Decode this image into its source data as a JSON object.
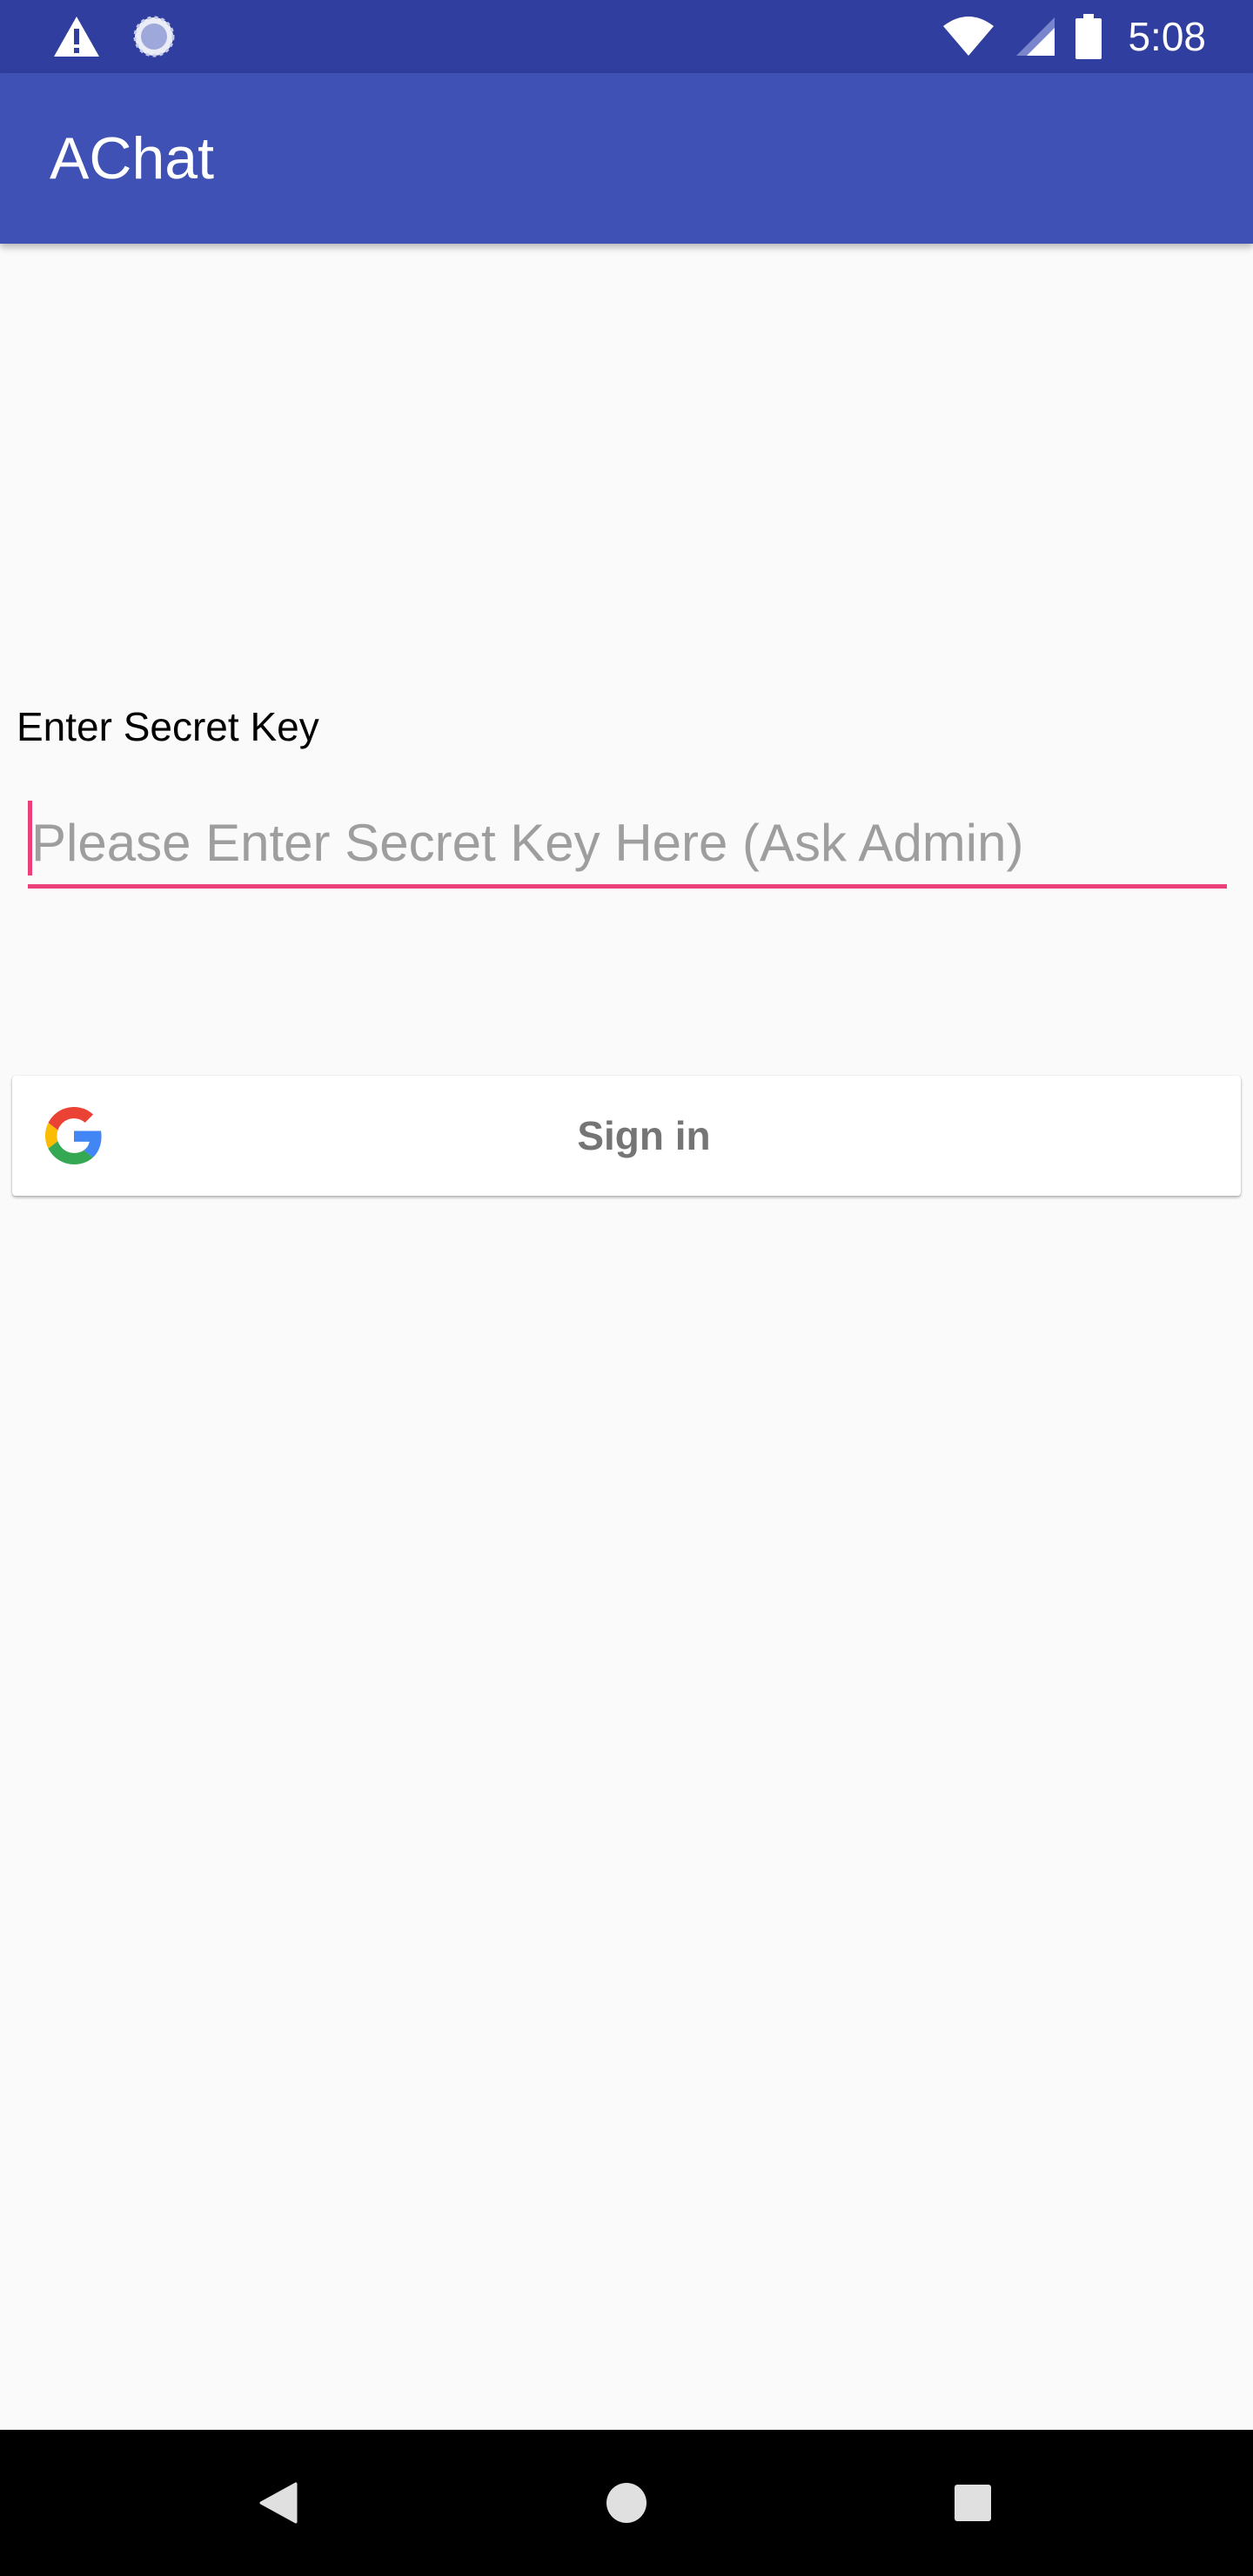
{
  "status_bar": {
    "time": "5:08",
    "icons": [
      "warning-icon",
      "loading-icon",
      "wifi-icon",
      "signal-icon",
      "battery-icon"
    ]
  },
  "app_bar": {
    "title": "AChat"
  },
  "secret_key": {
    "label": "Enter Secret Key",
    "value": "",
    "placeholder": "Please Enter Secret Key Here (Ask Admin)",
    "accent_color": "#ec407a"
  },
  "signin": {
    "label": "Sign in",
    "icon": "google-g-icon"
  },
  "nav_bar": {
    "icons": [
      "back-icon",
      "home-icon",
      "recents-icon"
    ]
  },
  "colors": {
    "status_bar": "#303f9f",
    "app_bar": "#3f51b5",
    "background": "#fafafa",
    "accent": "#ec407a",
    "nav_bar": "#000000"
  }
}
